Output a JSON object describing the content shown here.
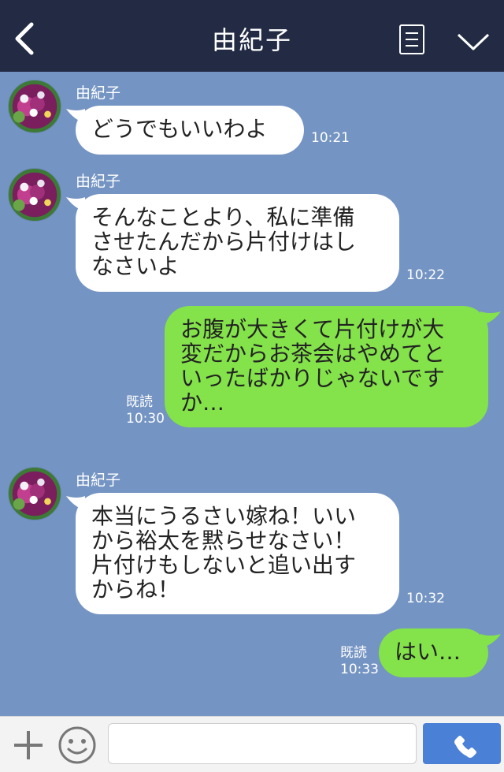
{
  "header": {
    "title": "由紀子",
    "back_icon": "chevron-left-icon",
    "memo_icon": "memo-icon",
    "menu_icon": "chevron-down-icon",
    "bg": "#232b44"
  },
  "colors": {
    "chat_bg": "#7494c3",
    "incoming_bubble": "#ffffff",
    "outgoing_bubble": "#84e24a",
    "send_button": "#4a80d6"
  },
  "messages": [
    {
      "direction": "incoming",
      "sender": "由紀子",
      "lines": [
        "どうでもいいわよ"
      ],
      "time": "10:21"
    },
    {
      "direction": "incoming",
      "sender": "由紀子",
      "lines": [
        "そんなことより、私に準備",
        "させたんだから片付けはし",
        "なさいよ"
      ],
      "time": "10:22"
    },
    {
      "direction": "outgoing",
      "lines": [
        "お腹が大きくて片付けが大",
        "変だからお茶会はやめてと",
        "いったばかりじゃないです",
        "か…"
      ],
      "read": "既読",
      "time": "10:30"
    },
    {
      "direction": "incoming",
      "sender": "由紀子",
      "lines": [
        "本当にうるさい嫁ね！いい",
        "から裕太を黙らせなさい！",
        "片付けもしないと追い出す",
        "からね！"
      ],
      "time": "10:32"
    },
    {
      "direction": "outgoing",
      "lines": [
        "はい…"
      ],
      "read": "既読",
      "time": "10:33"
    }
  ],
  "footer": {
    "plus_icon": "plus-icon",
    "emoji_icon": "smile-icon",
    "input_value": "",
    "call_icon": "phone-icon"
  }
}
